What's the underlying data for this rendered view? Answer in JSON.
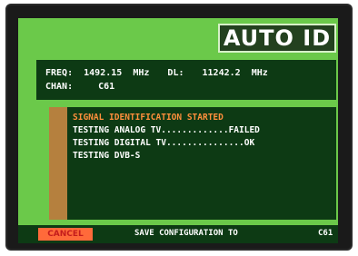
{
  "title": "AUTO ID",
  "info": {
    "freq_label": "FREQ:",
    "freq_value": "1492.15",
    "freq_unit": "MHz",
    "dl_label": "DL:",
    "dl_value": "11242.2",
    "dl_unit": "MHz",
    "chan_label": "CHAN:",
    "chan_value": "C61"
  },
  "messages": [
    "SIGNAL IDENTIFICATION STARTED",
    "TESTING ANALOG TV.............FAILED",
    "TESTING DIGITAL TV...............OK",
    "TESTING DVB-S"
  ],
  "bottom": {
    "cancel_label": "CANCEL",
    "save_label": "SAVE CONFIGURATION TO",
    "save_channel": "C61"
  },
  "colors": {
    "panel_green": "#6bc94a",
    "dark_green": "#0d3a14",
    "highlight_orange": "#ff8f3c",
    "cancel_bg": "#ff6a3a",
    "cancel_text": "#c41c1c",
    "side_bar": "#b5803e"
  }
}
